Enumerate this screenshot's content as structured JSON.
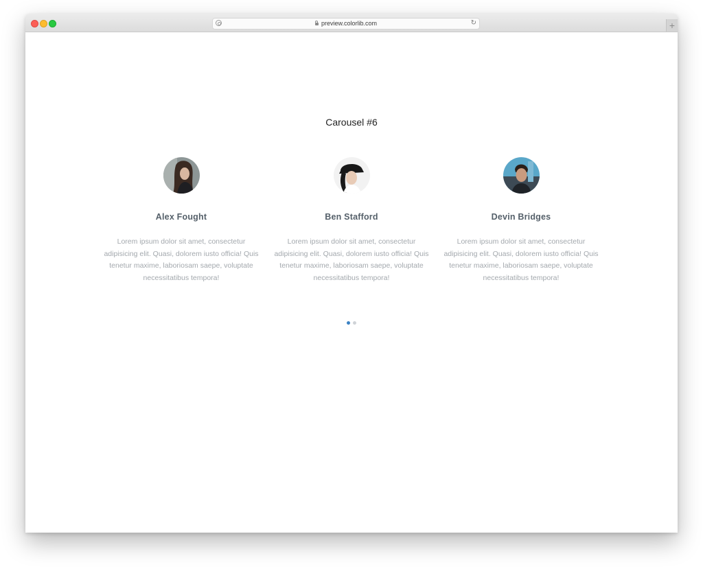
{
  "browser": {
    "url": "preview.colorlib.com",
    "new_tab_label": "+"
  },
  "page": {
    "title": "Carousel #6"
  },
  "testimonials": [
    {
      "name": "Alex Fought",
      "text": "Lorem ipsum dolor sit amet, consectetur adipisicing elit. Quasi, dolorem iusto officia! Quis tenetur maxime, laboriosam saepe, voluptate necessitatibus tempora!",
      "avatar": "woman-portrait"
    },
    {
      "name": "Ben Stafford",
      "text": "Lorem ipsum dolor sit amet, consectetur adipisicing elit. Quasi, dolorem iusto officia! Quis tenetur maxime, laboriosam saepe, voluptate necessitatibus tempora!",
      "avatar": "woman-hat-portrait"
    },
    {
      "name": "Devin Bridges",
      "text": "Lorem ipsum dolor sit amet, consectetur adipisicing elit. Quasi, dolorem iusto officia! Quis tenetur maxime, laboriosam saepe, voluptate necessitatibus tempora!",
      "avatar": "man-portrait"
    }
  ],
  "pagination": {
    "count": 2,
    "active_index": 0,
    "active_color": "#3b82c4",
    "inactive_color": "#cfd3d7"
  }
}
